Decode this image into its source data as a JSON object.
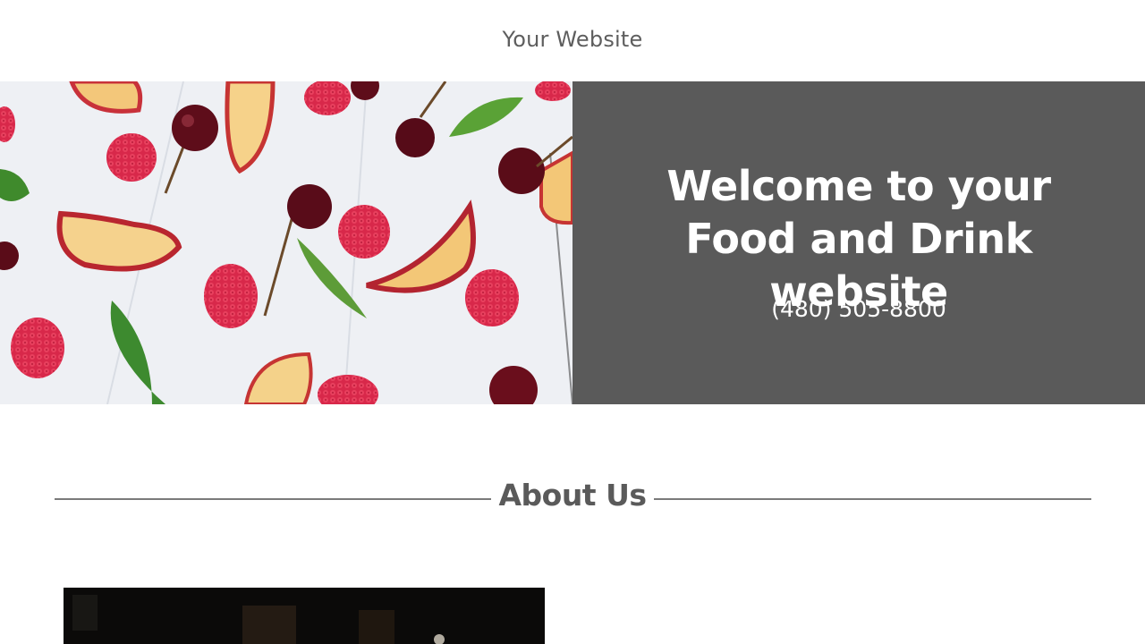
{
  "header": {
    "site_title": "Your Website"
  },
  "hero": {
    "heading": "Welcome to your Food and Drink website",
    "phone": "(480) 505-8800",
    "panel_color": "#5a5a5a"
  },
  "about": {
    "heading": "About Us"
  }
}
